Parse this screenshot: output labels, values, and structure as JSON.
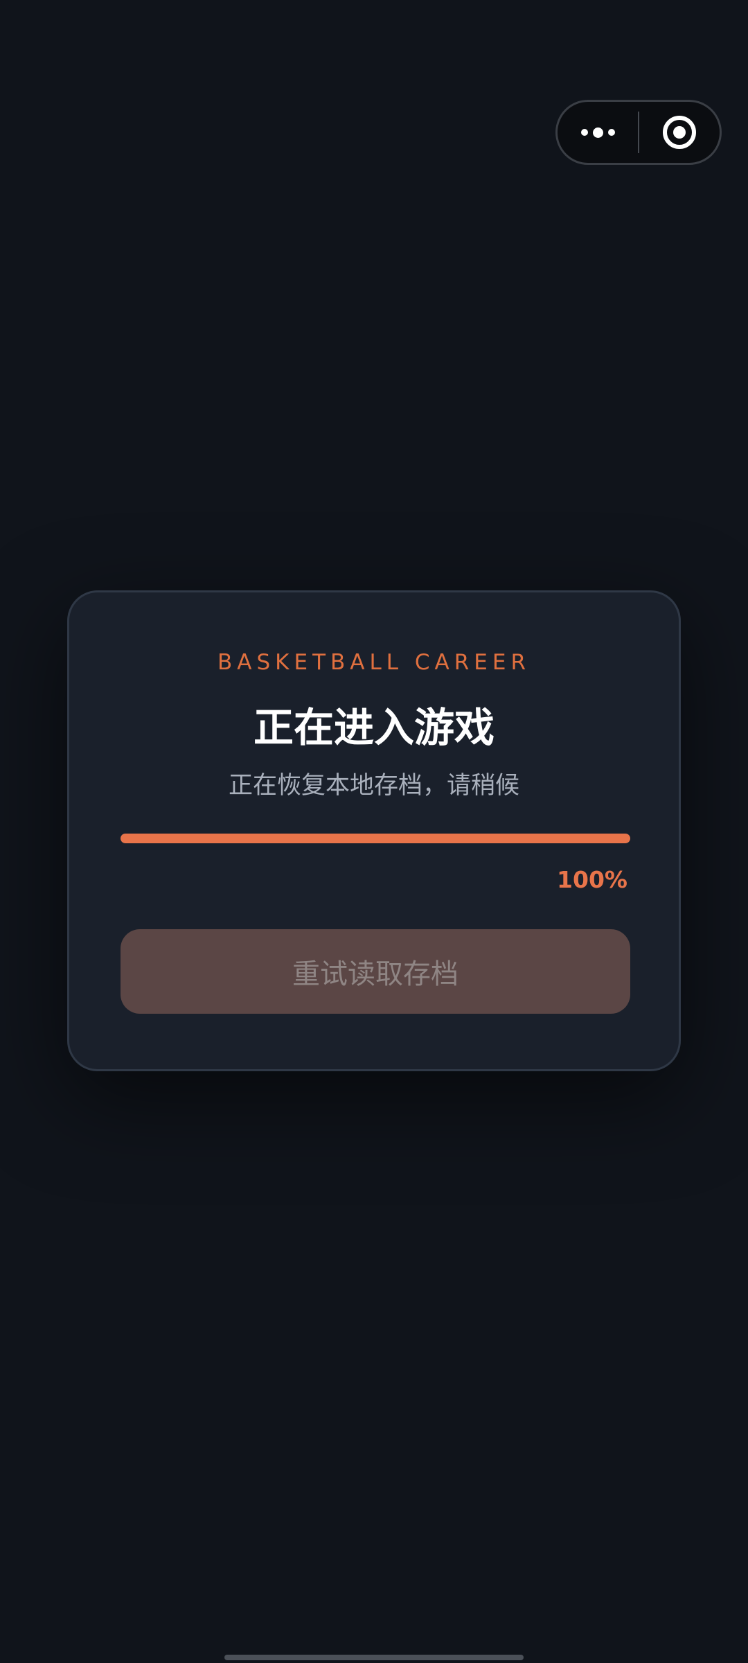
{
  "capsule": {
    "menu_icon": "more-dots-icon",
    "close_icon": "target-circle-icon"
  },
  "loader": {
    "eyebrow": "BASKETBALL CAREER",
    "title": "正在进入游戏",
    "subtitle": "正在恢复本地存档，请稍候",
    "progress": 1.0,
    "progress_label": "100%",
    "retry_label": "重试读取存档"
  },
  "colors": {
    "background": "#10141b",
    "card": "#1a202b",
    "accent": "#e8744a",
    "button_disabled": "#5b4645"
  }
}
